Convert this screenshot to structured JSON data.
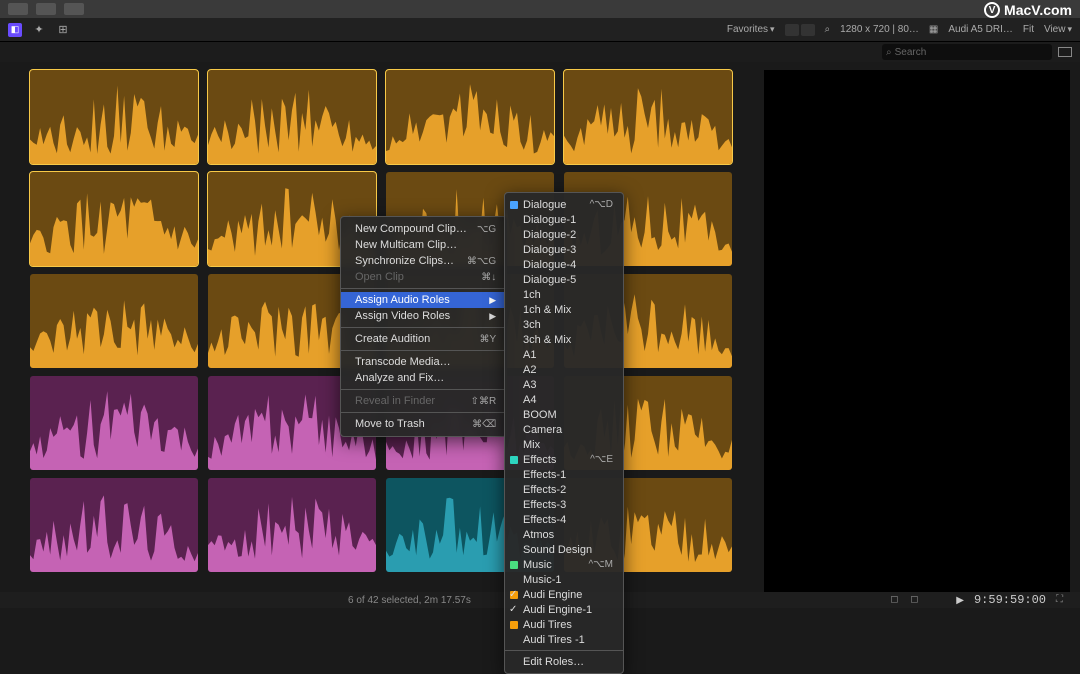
{
  "watermark": "MacV.com",
  "toolbar": {
    "favorites": "Favorites",
    "resolution": "1280 x 720 | 80…",
    "clip_name": "Audi A5 DRI…",
    "fit": "Fit",
    "view": "View"
  },
  "search": {
    "placeholder": "Search"
  },
  "status": {
    "selection": "6 of 42 selected, 2m 17.57s",
    "timecode": "9:59:59:00"
  },
  "clips": [
    {
      "color": "orange",
      "selected": true
    },
    {
      "color": "orange",
      "selected": true
    },
    {
      "color": "orange",
      "selected": true
    },
    {
      "color": "orange",
      "selected": true
    },
    {
      "color": "orange",
      "selected": true
    },
    {
      "color": "orange",
      "selected": true
    },
    {
      "color": "orange",
      "selected": false
    },
    {
      "color": "orange",
      "selected": false
    },
    {
      "color": "orange",
      "selected": false
    },
    {
      "color": "orange",
      "selected": false
    },
    {
      "color": "orange",
      "selected": false
    },
    {
      "color": "orange",
      "selected": false
    },
    {
      "color": "magenta",
      "selected": false
    },
    {
      "color": "magenta",
      "selected": false
    },
    {
      "color": "magenta",
      "selected": false
    },
    {
      "color": "orange",
      "selected": false
    },
    {
      "color": "magenta",
      "selected": false
    },
    {
      "color": "magenta",
      "selected": false
    },
    {
      "color": "teal",
      "selected": false
    },
    {
      "color": "orange",
      "selected": false
    }
  ],
  "context_menu": {
    "items": [
      {
        "label": "New Compound Clip…",
        "shortcut": "⌥G",
        "type": "item"
      },
      {
        "label": "New Multicam Clip…",
        "shortcut": "",
        "type": "item"
      },
      {
        "label": "Synchronize Clips…",
        "shortcut": "⌘⌥G",
        "type": "item"
      },
      {
        "label": "Open Clip",
        "shortcut": "⌘↓",
        "type": "item",
        "disabled": true
      },
      {
        "type": "sep"
      },
      {
        "label": "Assign Audio Roles",
        "type": "submenu",
        "highlight": true
      },
      {
        "label": "Assign Video Roles",
        "type": "submenu"
      },
      {
        "type": "sep"
      },
      {
        "label": "Create Audition",
        "shortcut": "⌘Y",
        "type": "item"
      },
      {
        "type": "sep"
      },
      {
        "label": "Transcode Media…",
        "type": "item"
      },
      {
        "label": "Analyze and Fix…",
        "type": "item"
      },
      {
        "type": "sep"
      },
      {
        "label": "Reveal in Finder",
        "shortcut": "⇧⌘R",
        "type": "item",
        "disabled": true
      },
      {
        "type": "sep"
      },
      {
        "label": "Move to Trash",
        "shortcut": "⌘⌫",
        "type": "item"
      }
    ]
  },
  "submenu": {
    "items": [
      {
        "label": "Dialogue",
        "shortcut": "^⌥D",
        "swatch": "#4aa3ff"
      },
      {
        "label": "Dialogue-1"
      },
      {
        "label": "Dialogue-2"
      },
      {
        "label": "Dialogue-3"
      },
      {
        "label": "Dialogue-4"
      },
      {
        "label": "Dialogue-5"
      },
      {
        "label": "1ch"
      },
      {
        "label": "1ch & Mix"
      },
      {
        "label": "3ch"
      },
      {
        "label": "3ch & Mix"
      },
      {
        "label": "A1"
      },
      {
        "label": "A2"
      },
      {
        "label": "A3"
      },
      {
        "label": "A4"
      },
      {
        "label": "BOOM"
      },
      {
        "label": "Camera"
      },
      {
        "label": "Mix"
      },
      {
        "label": "Effects",
        "shortcut": "^⌥E",
        "swatch": "#2dd4bf"
      },
      {
        "label": "Effects-1"
      },
      {
        "label": "Effects-2"
      },
      {
        "label": "Effects-3"
      },
      {
        "label": "Effects-4"
      },
      {
        "label": "Atmos"
      },
      {
        "label": "Sound Design"
      },
      {
        "label": "Music",
        "shortcut": "^⌥M",
        "swatch": "#4ade80"
      },
      {
        "label": "Music-1"
      },
      {
        "label": "Audi Engine",
        "swatch": "#f59e0b",
        "checked": true
      },
      {
        "label": "Audi Engine-1",
        "checked": true
      },
      {
        "label": "Audi Tires",
        "swatch": "#f59e0b"
      },
      {
        "label": "Audi Tires -1"
      },
      {
        "type": "sep"
      },
      {
        "label": "Edit Roles…"
      }
    ]
  }
}
